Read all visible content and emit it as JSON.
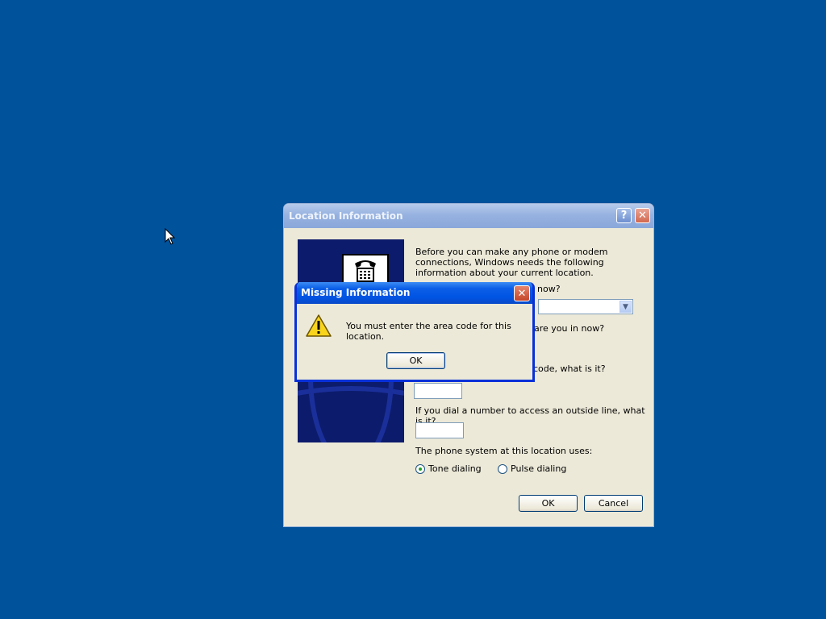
{
  "desktop": {
    "background": "#00529b"
  },
  "location_dialog": {
    "title": "Location Information",
    "help_label": "?",
    "close_label": "✕",
    "intro": "Before you can make any phone or modem connections, Windows needs the following information about your current location.",
    "q_country_fragment": "now?",
    "q_area_code_fragment": "are you in now?",
    "q_carrier_fragment": "code, what is it?",
    "q_outside_line": "If you dial a number to access an outside line, what is it?",
    "country_value": "",
    "area_code_value": "",
    "outside_line_value": "",
    "phone_system_label": "The phone system at this location uses:",
    "tone_label": "Tone dialing",
    "pulse_label": "Pulse dialing",
    "selected_dialing": "tone",
    "ok_label": "OK",
    "cancel_label": "Cancel"
  },
  "missing_info_dialog": {
    "title": "Missing Information",
    "close_label": "✕",
    "icon": "warning-icon",
    "message": "You must enter the area code for this location.",
    "ok_label": "OK"
  }
}
